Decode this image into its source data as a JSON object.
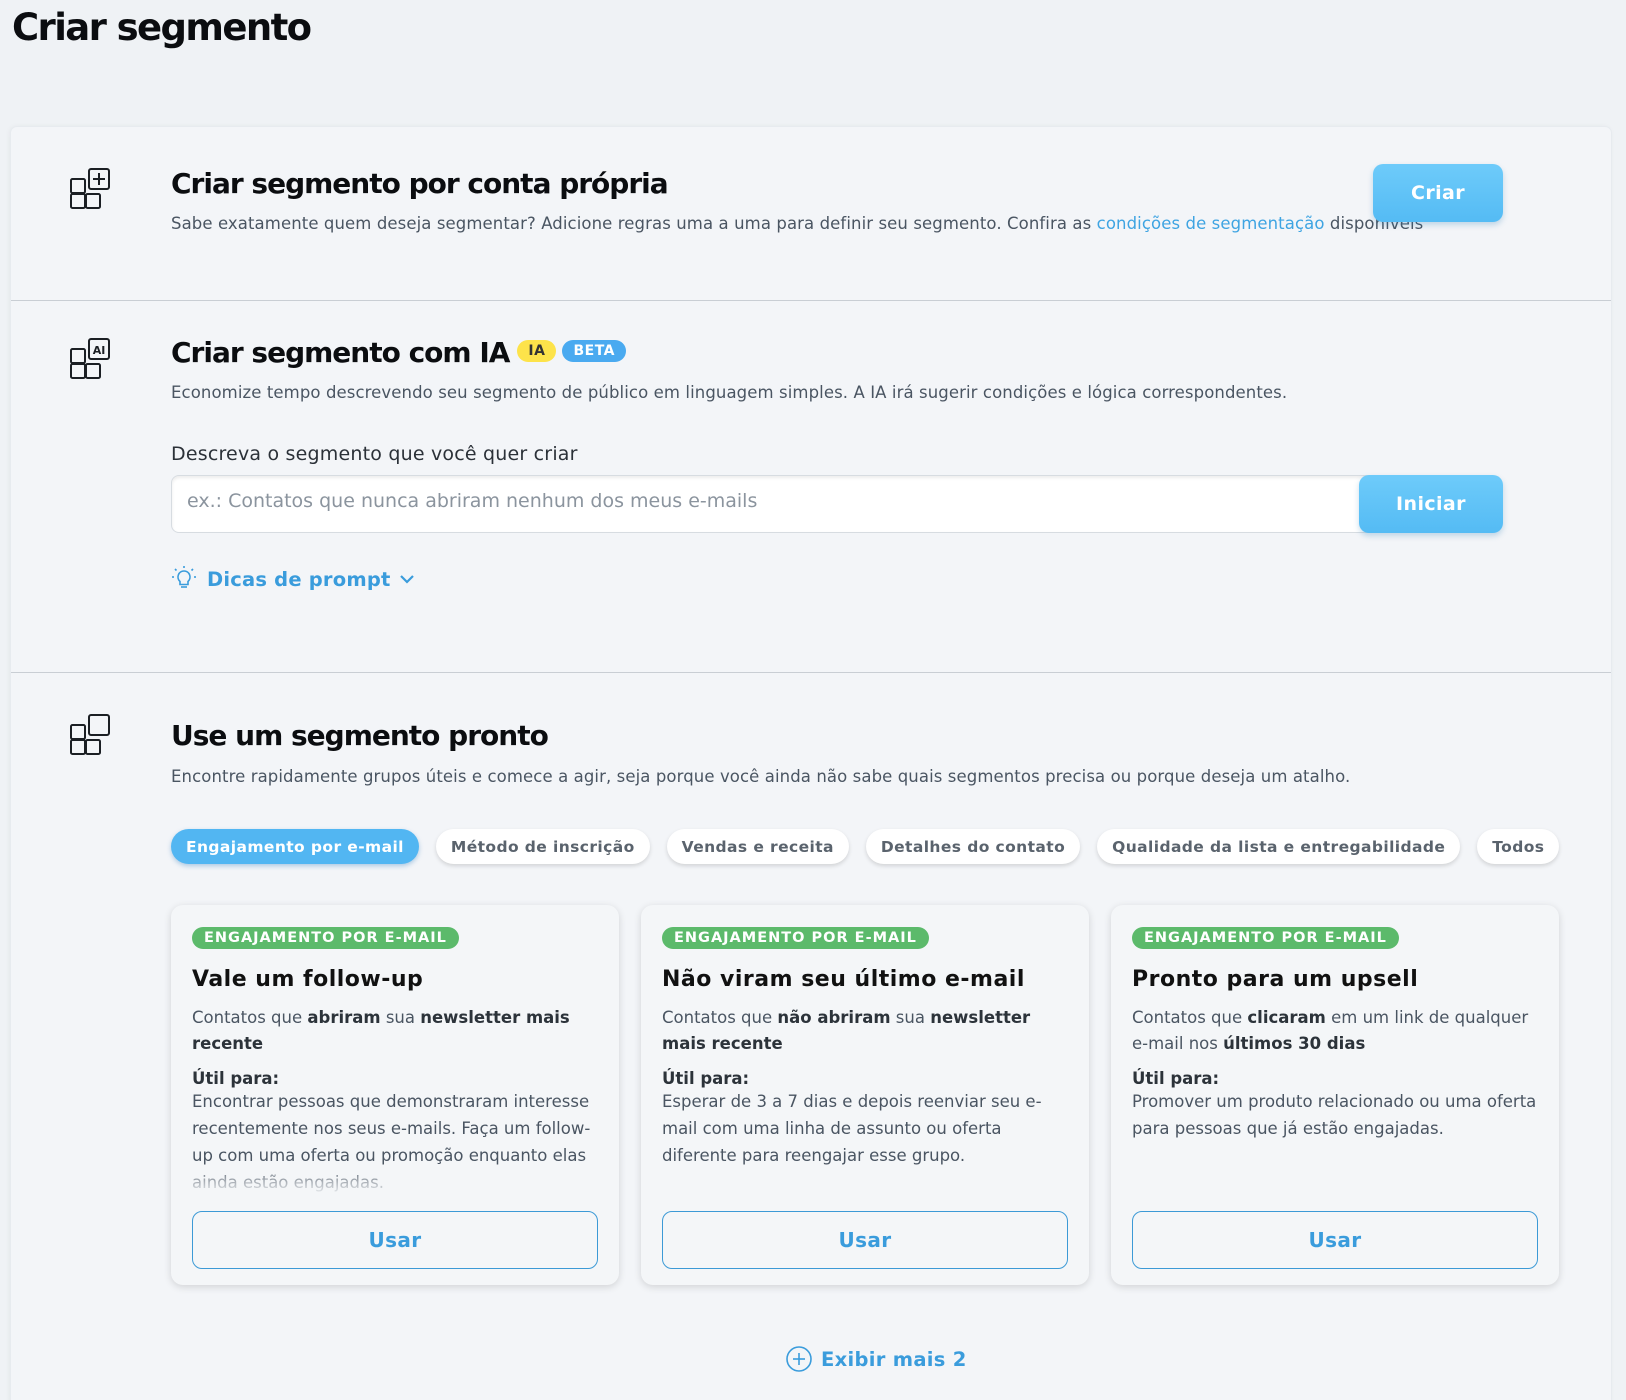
{
  "page": {
    "title": "Criar segmento"
  },
  "own": {
    "title": "Criar segmento por conta própria",
    "desc_before": "Sabe exatamente quem deseja segmentar? Adicione regras uma a uma para definir seu segmento. Confira as ",
    "desc_link": "condições de segmentação",
    "desc_after": " disponíveis",
    "button": "Criar",
    "icon": "grid-plus-icon"
  },
  "ai": {
    "title": "Criar segmento com IA",
    "badge_ia": "IA",
    "badge_beta": "BETA",
    "desc": "Economize tempo descrevendo seu segmento de público em linguagem simples. A IA irá sugerir condições e lógica correspondentes.",
    "field_label": "Descreva o segmento que você quer criar",
    "placeholder": "ex.: Contatos que nunca abriram nenhum dos meus e-mails",
    "value": "",
    "button": "Iniciar",
    "tips": "Dicas de prompt",
    "icon": "grid-ai-icon"
  },
  "ready": {
    "title": "Use um segmento pronto",
    "desc": "Encontre rapidamente grupos úteis e comece a agir, seja porque você ainda não sabe quais segmentos precisa ou porque deseja um atalho.",
    "icon": "grid-squares-icon",
    "filters": [
      {
        "label": "Engajamento por e-mail",
        "active": true
      },
      {
        "label": "Método de inscrição",
        "active": false
      },
      {
        "label": "Vendas e receita",
        "active": false
      },
      {
        "label": "Detalhes do contato",
        "active": false
      },
      {
        "label": "Qualidade da lista e entregabilidade",
        "active": false
      },
      {
        "label": "Todos",
        "active": false
      }
    ],
    "cards": [
      {
        "badge": "ENGAJAMENTO POR E-MAIL",
        "title": "Vale um follow-up",
        "desc": [
          "Contatos que ",
          "abriram",
          " sua ",
          "newsletter mais recente",
          ""
        ],
        "useful_label": "Útil para:",
        "useful_text": "Encontrar pessoas que demonstraram interesse recentemente nos seus e-mails. Faça um follow-up com uma oferta ou promoção enquanto elas ainda estão engajadas.",
        "button": "Usar"
      },
      {
        "badge": "ENGAJAMENTO POR E-MAIL",
        "title": "Não viram seu último e-mail",
        "desc": [
          "Contatos que ",
          "não abriram",
          " sua ",
          "newsletter mais recente",
          ""
        ],
        "useful_label": "Útil para:",
        "useful_text": "Esperar de 3 a 7 dias e depois reenviar seu e-mail com uma linha de assunto ou oferta diferente para reengajar esse grupo.",
        "button": "Usar"
      },
      {
        "badge": "ENGAJAMENTO POR E-MAIL",
        "title": "Pronto para um upsell",
        "desc": [
          "Contatos que ",
          "clicaram",
          " em um link de qualquer e-mail nos ",
          "últimos 30 dias",
          ""
        ],
        "useful_label": "Útil para:",
        "useful_text": "Promover um produto relacionado ou uma oferta para pessoas que já estão engajadas.",
        "button": "Usar"
      }
    ],
    "show_more": "Exibir mais 2"
  },
  "colors": {
    "accent": "#52b6f2",
    "link": "#3ea4e2",
    "badge_ia": "#fde34a",
    "badge_beta": "#4aaaf0",
    "card_badge": "#5cba6b"
  }
}
